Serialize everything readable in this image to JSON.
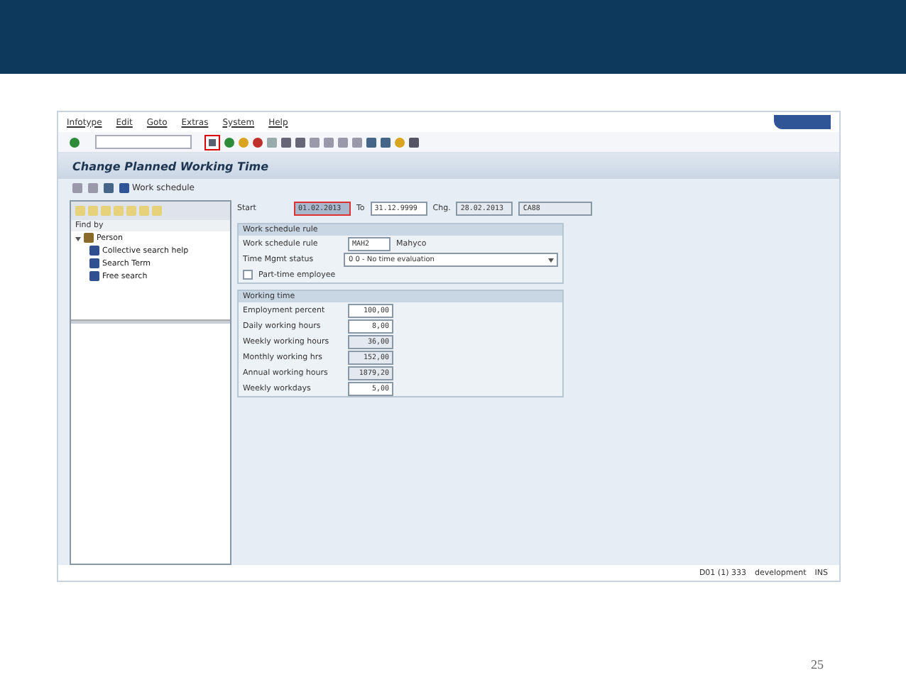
{
  "menu": [
    "Infotype",
    "Edit",
    "Goto",
    "Extras",
    "System",
    "Help"
  ],
  "toolbar": {
    "save_highlighted": true
  },
  "title": "Change Planned Working Time",
  "app_toolbar": {
    "button": "Work schedule"
  },
  "tree": {
    "header": "Find by",
    "root": {
      "label": "Person",
      "expanded": true,
      "children": [
        {
          "label": "Collective search help"
        },
        {
          "label": "Search Term"
        },
        {
          "label": "Free search"
        }
      ]
    }
  },
  "period": {
    "start_label": "Start",
    "start": "01.02.2013",
    "to_label": "To",
    "to": "31.12.9999",
    "chg_label": "Chg.",
    "chg_date": "28.02.2013",
    "chg_user": "CA88"
  },
  "groups": [
    {
      "title": "Work schedule rule",
      "rows": [
        {
          "kind": "field",
          "label": "Work schedule rule",
          "value": "MAH2",
          "text": "Mahyco"
        },
        {
          "kind": "dropdown",
          "label": "Time Mgmt status",
          "value": "0 0 - No time evaluation"
        },
        {
          "kind": "checkbox",
          "label": "Part-time employee",
          "checked": false
        }
      ]
    },
    {
      "title": "Working time",
      "rows": [
        {
          "kind": "number",
          "label": "Employment percent",
          "value": "100,00",
          "editable": true
        },
        {
          "kind": "number",
          "label": "Daily working hours",
          "value": "8,00",
          "editable": true
        },
        {
          "kind": "number",
          "label": "Weekly working hours",
          "value": "36,00",
          "editable": false
        },
        {
          "kind": "number",
          "label": "Monthly working hrs",
          "value": "152,00",
          "editable": false
        },
        {
          "kind": "number",
          "label": "Annual working hours",
          "value": "1879,20",
          "editable": false
        },
        {
          "kind": "number",
          "label": "Weekly workdays",
          "value": "5,00",
          "editable": true
        }
      ]
    }
  ],
  "status_bar": {
    "system": "D01 (1) 333",
    "server": "development",
    "mode": "INS"
  },
  "slide_number": "25"
}
